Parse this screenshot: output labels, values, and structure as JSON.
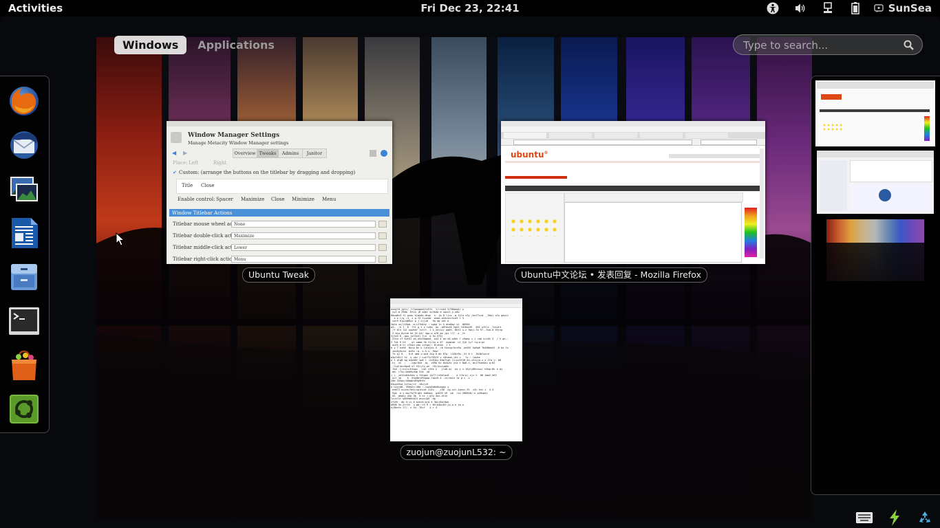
{
  "topbar": {
    "activities_label": "Activities",
    "clock": "Fri Dec 23, 22:41",
    "user_name": "SunSea",
    "icons": [
      "accessibility-icon",
      "volume-icon",
      "network-icon",
      "battery-icon",
      "user-status-icon"
    ]
  },
  "view_tabs": [
    {
      "label": "Windows",
      "active": true
    },
    {
      "label": "Applications",
      "active": false
    }
  ],
  "search": {
    "placeholder": "Type to search..."
  },
  "dash": {
    "items": [
      "firefox-icon",
      "thunderbird-icon",
      "shotwell-icon",
      "libreoffice-writer-icon",
      "file-manager-icon",
      "terminal-icon",
      "software-center-icon",
      "ubuntu-tweak-icon"
    ]
  },
  "windows": [
    {
      "caption": "Ubuntu Tweak"
    },
    {
      "caption": "Ubuntu中文论坛 • 发表回复 - Mozilla Firefox"
    },
    {
      "caption": "zuojun@zuojunL532: ~"
    }
  ],
  "tweak_window": {
    "title": "Window Manager Settings",
    "subtitle": "Manage Metacity Window Manager settings",
    "tabs": [
      "Overview",
      "Tweaks",
      "Admins",
      "Janitor"
    ],
    "place_label": "Place:",
    "place_left": "Left",
    "place_right": "Right",
    "custom_label": "Custom: (arrange the buttons on the titlebar by dragging and dropping)",
    "title_label": "Title",
    "close_label": "Close",
    "enable_control": "Enable control:",
    "controls": [
      "Spacer",
      "Maximize",
      "Close",
      "Minimize",
      "Menu"
    ],
    "section": "Window Titlebar Actions",
    "rows": [
      {
        "label": "Titlebar mouse wheel action",
        "value": "None"
      },
      {
        "label": "Titlebar double-click action",
        "value": "Maximize"
      },
      {
        "label": "Titlebar middle-click action",
        "value": "Lower"
      },
      {
        "label": "Titlebar right-click action",
        "value": "Menu"
      }
    ]
  },
  "colors": {
    "accent_blue": "#3c84d4",
    "ubuntu_orange": "#dd4814",
    "panel_black": "#000000"
  },
  "bottom_tray": {
    "icons": [
      "keyboard-icon",
      "power-icon",
      "recycle-icon"
    ]
  }
}
